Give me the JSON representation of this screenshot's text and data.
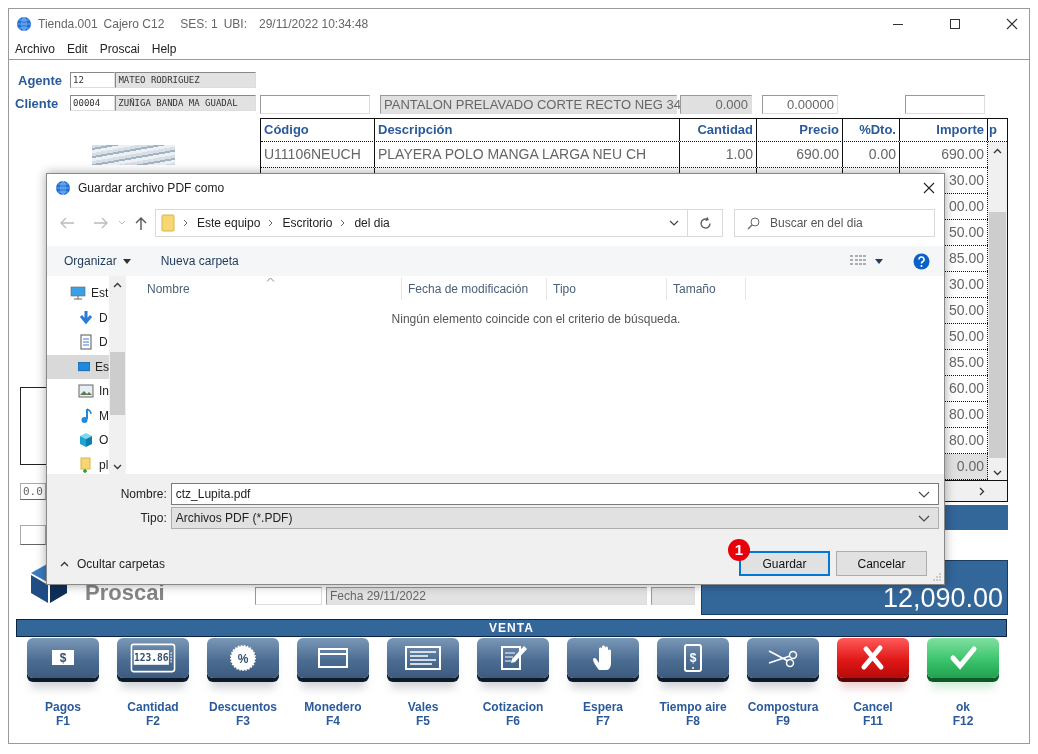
{
  "window": {
    "title": {
      "store": "Tienda.001",
      "cashier": "Cajero C12",
      "session": "SES: 1",
      "location": "UBI:",
      "datetime": "29/11/2022 10:34:48"
    }
  },
  "menu": [
    "Archivo",
    "Edit",
    "Proscai",
    "Help"
  ],
  "agent": {
    "label": "Agente",
    "code": "12",
    "name": "MATEO RODRIGUEZ"
  },
  "client": {
    "label": "Cliente",
    "code": "00004",
    "name": "ZUÑIGA BANDA MA GUADAL"
  },
  "item_entry": {
    "description": "PANTALON PRELAVADO CORTE RECTO NEG 34",
    "quantity": "0.000",
    "price": "0.00000"
  },
  "table": {
    "columns": [
      "Código",
      "Descripción",
      "Cantidad",
      "Precio",
      "%Dto.",
      "Importe",
      "p"
    ],
    "rows": [
      {
        "code": "U11106NEUCH",
        "description": "PLAYERA POLO MANGA LARGA NEU CH",
        "quantity": "1.00",
        "price": "690.00",
        "discount": "0.00",
        "amount": "690.00",
        "selected": false
      },
      {
        "amount": "30.00",
        "selected": false
      },
      {
        "amount": "00.00",
        "selected": false
      },
      {
        "amount": "50.00",
        "selected": false
      },
      {
        "amount": "85.00",
        "selected": false
      },
      {
        "amount": "30.00",
        "selected": false
      },
      {
        "amount": "50.00",
        "selected": false
      },
      {
        "amount": "50.00",
        "selected": false
      },
      {
        "amount": "85.00",
        "selected": false
      },
      {
        "amount": "60.00",
        "selected": false
      },
      {
        "amount": "80.00",
        "selected": false
      },
      {
        "amount": "80.00",
        "selected": false
      },
      {
        "amount": "0.00",
        "selected": true
      }
    ]
  },
  "discount_field": "0.0",
  "logo": "Proscai",
  "date_field": "Fecha 29/11/2022",
  "total": "12,090.00",
  "mode_bar": "VENTA",
  "function_keys": [
    {
      "label": "Pagos",
      "key": "F1",
      "kind": "bill",
      "icon_text": "$"
    },
    {
      "label": "Cantidad",
      "key": "F2",
      "kind": "calculator",
      "icon_text": "123.86"
    },
    {
      "label": "Descuentos",
      "key": "F3",
      "kind": "discount",
      "icon_text": "%"
    },
    {
      "label": "Monedero",
      "key": "F4",
      "kind": "card"
    },
    {
      "label": "Vales",
      "key": "F5",
      "kind": "voucher"
    },
    {
      "label": "Cotizacion",
      "key": "F6",
      "kind": "edit"
    },
    {
      "label": "Espera",
      "key": "F7",
      "kind": "hand"
    },
    {
      "label": "Tiempo aire",
      "key": "F8",
      "kind": "phone",
      "icon_text": "$"
    },
    {
      "label": "Compostura",
      "key": "F9",
      "kind": "scissors"
    },
    {
      "label": "Cancel",
      "key": "F11",
      "kind": "cancel"
    },
    {
      "label": "ok",
      "key": "F12",
      "kind": "confirm"
    }
  ],
  "dialog": {
    "title": "Guardar archivo PDF como",
    "breadcrumb": [
      "Este equipo",
      "Escritorio",
      "del dia"
    ],
    "search_placeholder": "Buscar en del dia",
    "organize": "Organizar",
    "new_folder": "Nueva carpeta",
    "nav_items": [
      {
        "label": "Est",
        "kind": "computer",
        "selected": false
      },
      {
        "label": "D",
        "kind": "download",
        "selected": false
      },
      {
        "label": "D",
        "kind": "document",
        "selected": false
      },
      {
        "label": "Es",
        "kind": "desktop",
        "selected": true
      },
      {
        "label": "In",
        "kind": "pictures",
        "selected": false
      },
      {
        "label": "M",
        "kind": "music",
        "selected": false
      },
      {
        "label": "O",
        "kind": "objects",
        "selected": false
      },
      {
        "label": "pl",
        "kind": "folder",
        "selected": false
      }
    ],
    "columns": [
      "Nombre",
      "Fecha de modificación",
      "Tipo",
      "Tamaño"
    ],
    "empty_message": "Ningún elemento coincide con el criterio de búsqueda.",
    "filename_label": "Nombre:",
    "filename": "ctz_Lupita.pdf",
    "type_label": "Tipo:",
    "type": "Archivos PDF (*.PDF)",
    "hide_folders": "Ocultar carpetas",
    "buttons": [
      {
        "label": "Guardar",
        "focused": true
      },
      {
        "label": "Cancelar",
        "focused": false
      }
    ],
    "badge": "1"
  }
}
